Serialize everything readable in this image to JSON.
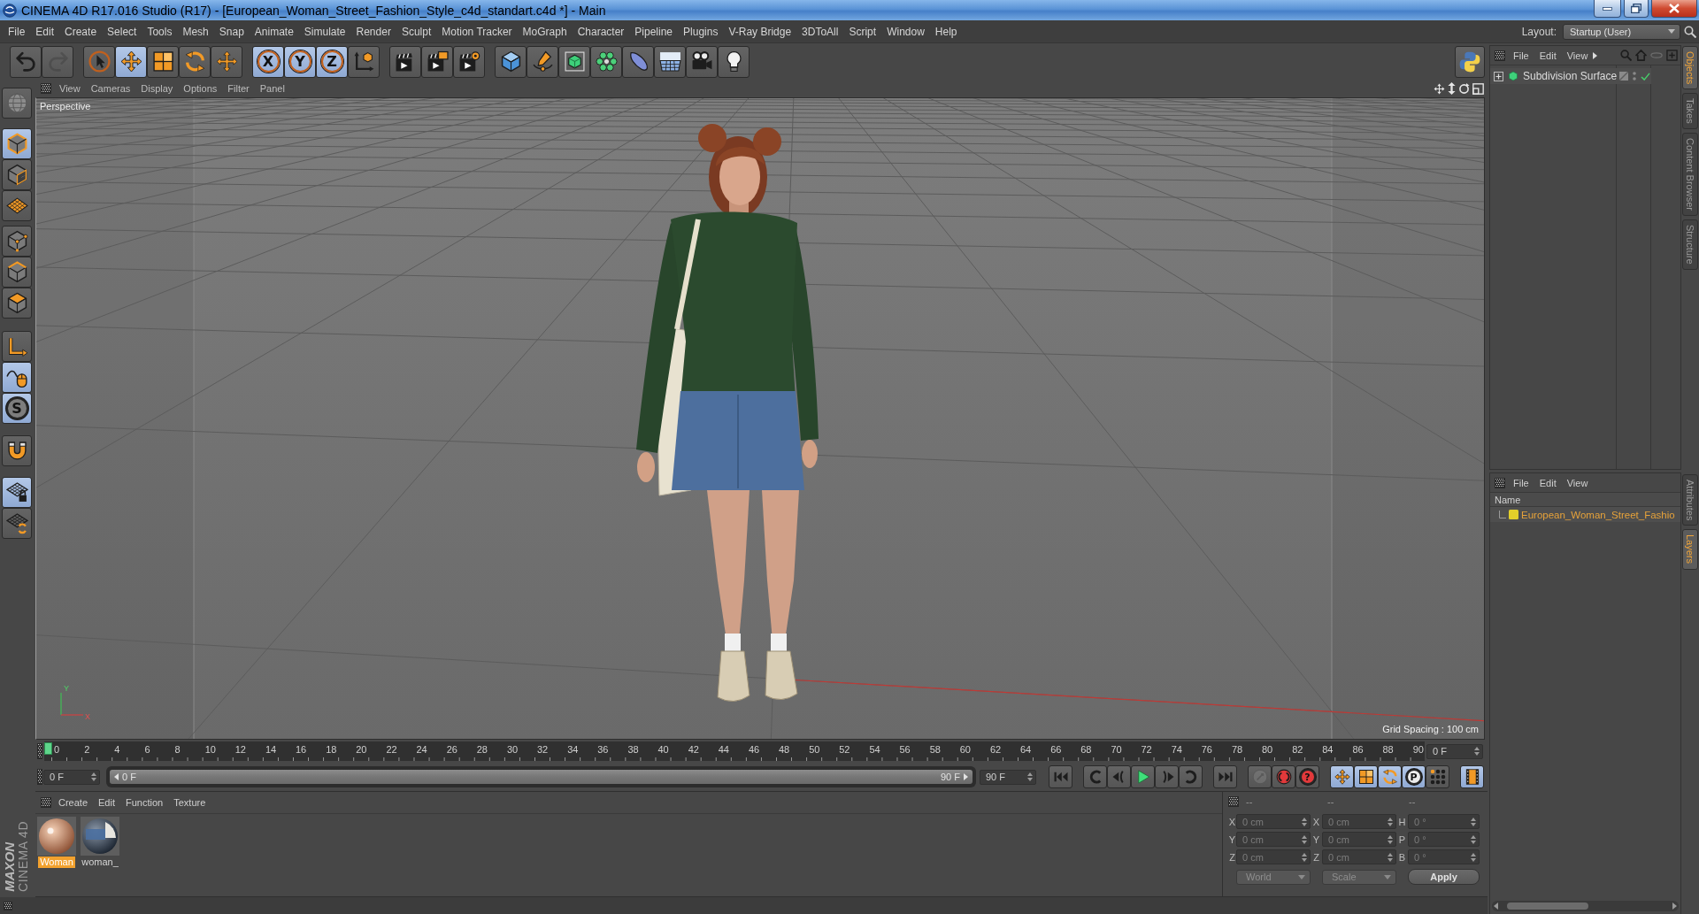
{
  "window": {
    "title": "CINEMA 4D R17.016 Studio (R17) - [European_Woman_Street_Fashion_Style_c4d_standart.c4d *] - Main"
  },
  "menu_bar": {
    "items": [
      "File",
      "Edit",
      "Create",
      "Select",
      "Tools",
      "Mesh",
      "Snap",
      "Animate",
      "Simulate",
      "Render",
      "Sculpt",
      "Motion Tracker",
      "MoGraph",
      "Character",
      "Pipeline",
      "Plugins",
      "V-Ray Bridge",
      "3DToAll",
      "Script",
      "Window",
      "Help"
    ],
    "layout_label": "Layout:",
    "layout_value": "Startup (User)"
  },
  "toolbar": {
    "groups": [
      {
        "buttons": [
          {
            "kind": "undo",
            "selected": false,
            "disabled": false
          },
          {
            "kind": "redo",
            "selected": false,
            "disabled": true
          }
        ]
      },
      {
        "buttons": [
          {
            "kind": "select",
            "selected": false,
            "disabled": false
          },
          {
            "kind": "move",
            "selected": true,
            "disabled": false
          },
          {
            "kind": "scale",
            "selected": false,
            "disabled": false
          },
          {
            "kind": "rotate",
            "selected": false,
            "disabled": false
          },
          {
            "kind": "recent",
            "selected": false,
            "disabled": false
          }
        ]
      },
      {
        "buttons": [
          {
            "kind": "axis",
            "label": "X",
            "selected": true,
            "disabled": false
          },
          {
            "kind": "axis",
            "label": "Y",
            "selected": true,
            "disabled": false
          },
          {
            "kind": "axis",
            "label": "Z",
            "selected": true,
            "disabled": false
          },
          {
            "kind": "coordinates",
            "selected": false,
            "disabled": false
          }
        ]
      },
      {
        "buttons": [
          {
            "kind": "render_view",
            "selected": false,
            "disabled": false
          },
          {
            "kind": "render_picture",
            "selected": false,
            "disabled": false
          },
          {
            "kind": "render_settings",
            "selected": false,
            "disabled": false
          }
        ]
      },
      {
        "buttons": [
          {
            "kind": "cube",
            "selected": false,
            "disabled": false
          },
          {
            "kind": "pen",
            "selected": false,
            "disabled": false
          },
          {
            "kind": "subdivision",
            "selected": false,
            "disabled": false
          },
          {
            "kind": "cloner",
            "selected": false,
            "disabled": false
          },
          {
            "kind": "deformer",
            "selected": false,
            "disabled": false
          },
          {
            "kind": "floor",
            "selected": false,
            "disabled": false
          },
          {
            "kind": "camera",
            "selected": false,
            "disabled": false
          },
          {
            "kind": "light",
            "selected": false,
            "disabled": false
          }
        ]
      }
    ],
    "end_buttons": [
      {
        "kind": "python",
        "selected": false,
        "disabled": false
      }
    ]
  },
  "tool_palette": {
    "groups": [
      {
        "buttons": [
          {
            "kind": "globe",
            "selected": false
          }
        ]
      },
      {
        "buttons": [
          {
            "kind": "model",
            "selected": true
          },
          {
            "kind": "texture",
            "selected": false
          },
          {
            "kind": "workplane",
            "selected": false
          }
        ]
      },
      {
        "buttons": [
          {
            "kind": "points",
            "selected": false
          },
          {
            "kind": "edges",
            "selected": false
          },
          {
            "kind": "polygons",
            "selected": false
          }
        ]
      },
      {
        "buttons": [
          {
            "kind": "axis_mode",
            "selected": false
          },
          {
            "kind": "tweak",
            "selected": true
          },
          {
            "kind": "solo",
            "label": "S",
            "selected": true
          }
        ]
      },
      {
        "buttons": [
          {
            "kind": "snap",
            "selected": false
          }
        ]
      },
      {
        "buttons": [
          {
            "kind": "grid_lock",
            "selected": true
          },
          {
            "kind": "grid_rotate",
            "selected": false
          }
        ]
      }
    ]
  },
  "logo": {
    "brand": "MAXON",
    "product": "CINEMA 4D"
  },
  "viewport": {
    "menu": [
      "View",
      "Cameras",
      "Display",
      "Options",
      "Filter",
      "Panel"
    ],
    "camera": "Perspective",
    "gizmo": {
      "y": "Y",
      "x": "X"
    },
    "grid_spacing": "Grid Spacing : 100 cm"
  },
  "timeline": {
    "labels": [
      "0",
      "2",
      "4",
      "6",
      "8",
      "10",
      "12",
      "14",
      "16",
      "18",
      "20",
      "22",
      "24",
      "26",
      "28",
      "30",
      "32",
      "34",
      "36",
      "38",
      "40",
      "42",
      "44",
      "46",
      "48",
      "50",
      "52",
      "54",
      "56",
      "58",
      "60",
      "62",
      "64",
      "66",
      "68",
      "70",
      "72",
      "74",
      "76",
      "78",
      "80",
      "82",
      "84",
      "86",
      "88",
      "90"
    ],
    "level": 0,
    "current_frame": "0 F",
    "start_field": "0 F",
    "range": {
      "start": "0 F",
      "end": "90 F",
      "level": 1
    },
    "end_field": "90 F"
  },
  "playback": {
    "groups": [
      {
        "buttons": [
          {
            "kind": "start",
            "selected": false,
            "disabled": false
          }
        ]
      },
      {
        "buttons": [
          {
            "kind": "prev_key",
            "selected": false,
            "disabled": false
          },
          {
            "kind": "prev_frame",
            "selected": false,
            "disabled": false
          },
          {
            "kind": "play",
            "selected": false,
            "disabled": false
          },
          {
            "kind": "next_frame",
            "selected": false,
            "disabled": false
          },
          {
            "kind": "next_key",
            "selected": false,
            "disabled": false
          }
        ]
      },
      {
        "buttons": [
          {
            "kind": "end",
            "selected": false,
            "disabled": false
          }
        ]
      },
      {
        "buttons": [
          {
            "kind": "record",
            "selected": false,
            "disabled": true
          },
          {
            "kind": "autokey",
            "selected": false,
            "disabled": false
          },
          {
            "kind": "keysel",
            "label": "?",
            "selected": false,
            "disabled": false
          }
        ]
      },
      {
        "buttons": [
          {
            "kind": "key_move",
            "selected": true,
            "disabled": false
          },
          {
            "kind": "key_scale",
            "selected": true,
            "disabled": false
          },
          {
            "kind": "key_rotate",
            "selected": true,
            "disabled": false
          },
          {
            "kind": "key_param",
            "label": "P",
            "selected": true,
            "disabled": false
          },
          {
            "kind": "key_points",
            "selected": false,
            "disabled": false
          }
        ]
      },
      {
        "buttons": [
          {
            "kind": "timeline",
            "selected": true,
            "disabled": false
          }
        ]
      }
    ]
  },
  "materials": {
    "menu": [
      "Create",
      "Edit",
      "Function",
      "Texture"
    ],
    "items": [
      {
        "name": "Woman",
        "kind": "skin",
        "selected": true
      },
      {
        "name": "woman_",
        "kind": "fabric",
        "selected": false
      }
    ]
  },
  "coordinates": {
    "headers": [
      "--",
      "--",
      "--"
    ],
    "rows": [
      {
        "axis": "X",
        "position": "0 cm",
        "size_axis": "X",
        "size": "0 cm",
        "rotation_axis": "H",
        "rotation": "0 °"
      },
      {
        "axis": "Y",
        "position": "0 cm",
        "size_axis": "Y",
        "size": "0 cm",
        "rotation_axis": "P",
        "rotation": "0 °"
      },
      {
        "axis": "Z",
        "position": "0 cm",
        "size_axis": "Z",
        "size": "0 cm",
        "rotation_axis": "B",
        "rotation": "0 °"
      }
    ],
    "space": "World",
    "mode": "Scale",
    "apply": "Apply"
  },
  "objects_panel": {
    "menu": [
      "File",
      "Edit",
      "View"
    ],
    "objects": [
      {
        "name": "Subdivision Surface",
        "expanded": false,
        "enabled": true
      }
    ]
  },
  "side_tabs_top": [
    {
      "label": "Objects",
      "selected": true
    },
    {
      "label": "Takes",
      "selected": false
    },
    {
      "label": "Content Browser",
      "selected": false
    },
    {
      "label": "Structure",
      "selected": false
    }
  ],
  "layers_panel": {
    "menu": [
      "File",
      "Edit",
      "View"
    ],
    "column": "Name",
    "layers": [
      {
        "name": "European_Woman_Street_Fashio",
        "color": "#e3cf2a"
      }
    ]
  },
  "side_tabs_bottom": [
    {
      "label": "Attributes",
      "selected": false
    },
    {
      "label": "Layers",
      "selected": true
    }
  ]
}
